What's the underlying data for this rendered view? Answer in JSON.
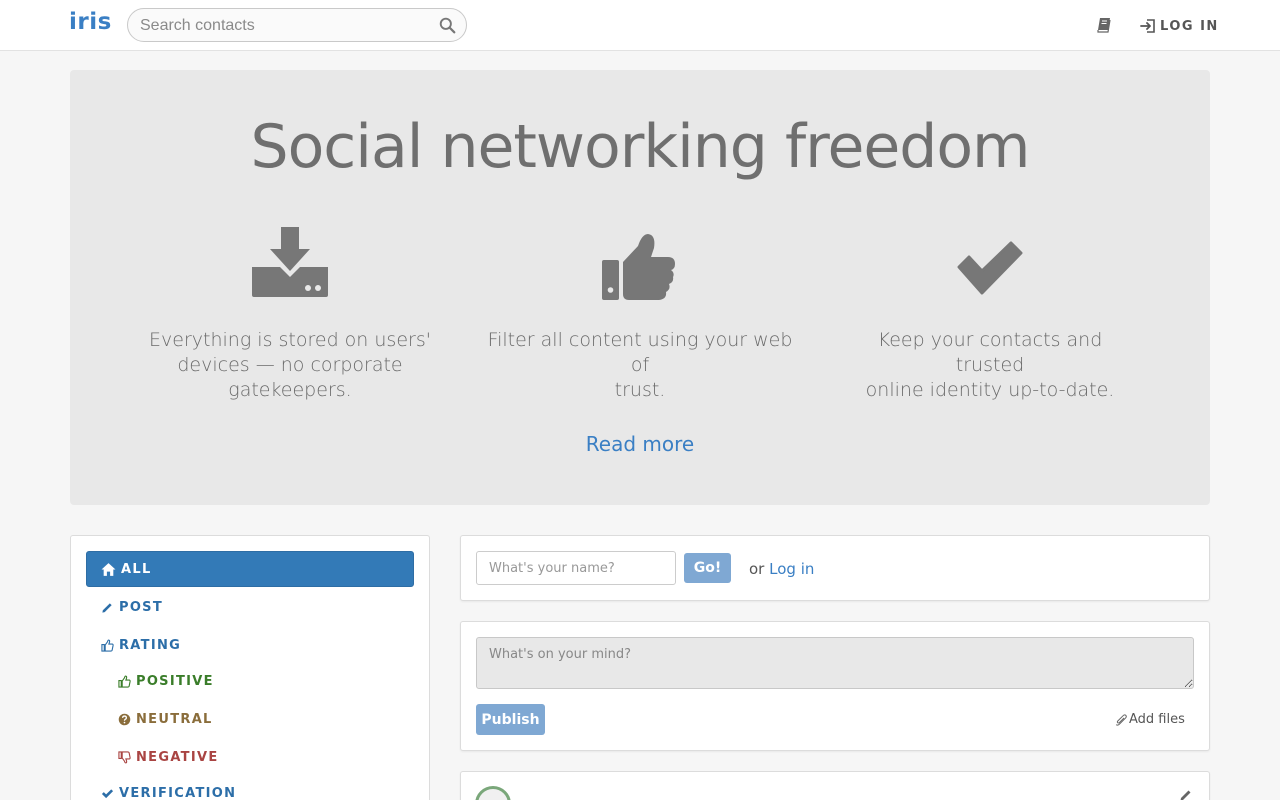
{
  "navbar": {
    "logo": "iris",
    "search_placeholder": "Search contacts",
    "login_label": "LOG IN",
    "icons": [
      "search-icon",
      "book-icon",
      "sign-in-icon"
    ]
  },
  "hero": {
    "title": "Social networking freedom",
    "features": [
      {
        "icon": "download-icon",
        "line1": "Everything is stored on users'",
        "line2": "devices — no corporate",
        "line3": "gatekeepers."
      },
      {
        "icon": "thumbs-up-icon",
        "line1": "Filter all content using your web of",
        "line2": "trust."
      },
      {
        "icon": "checkmark-icon",
        "line1": "Keep your contacts and trusted",
        "line2": "online identity up-to-date."
      }
    ],
    "read_more": "Read more"
  },
  "filters": {
    "all": "ALL",
    "post": "POST",
    "rating": "RATING",
    "positive": "POSITIVE",
    "neutral": "NEUTRAL",
    "negative": "NEGATIVE",
    "verification": "VERIFICATION"
  },
  "login_panel": {
    "name_placeholder": "What's your name?",
    "go_label": "Go!",
    "or_label": "or",
    "login_label": "Log in"
  },
  "compose": {
    "placeholder": "What's on your mind?",
    "publish_label": "Publish",
    "add_files_label": "Add files"
  },
  "colors": {
    "brand": "#3a7fc4",
    "active_filter": "#337ab7",
    "positive": "#3a7d2a",
    "neutral": "#8a6d3b",
    "negative": "#a94442",
    "button": "#7fa8d3"
  }
}
